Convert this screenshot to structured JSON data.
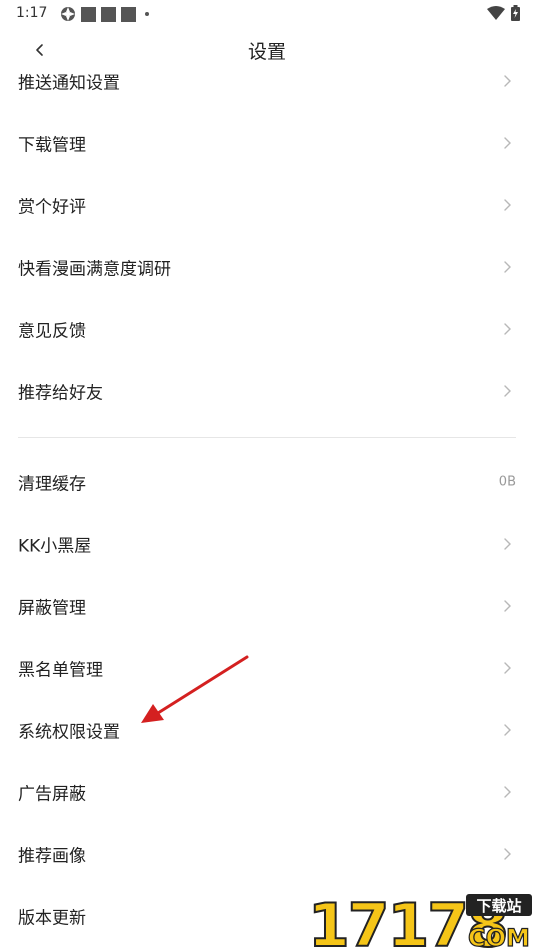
{
  "status_bar": {
    "time": "1:17"
  },
  "header": {
    "title": "设置"
  },
  "groups": [
    {
      "items": [
        {
          "label": "推送通知设置"
        },
        {
          "label": "下载管理"
        },
        {
          "label": "赏个好评"
        },
        {
          "label": "快看漫画满意度调研"
        },
        {
          "label": "意见反馈"
        },
        {
          "label": "推荐给好友"
        }
      ]
    },
    {
      "items": [
        {
          "label": "清理缓存",
          "value": "0B"
        },
        {
          "label": "KK小黑屋"
        },
        {
          "label": "屏蔽管理"
        },
        {
          "label": "黑名单管理"
        },
        {
          "label": "系统权限设置"
        },
        {
          "label": "广告屏蔽"
        },
        {
          "label": "推荐画像"
        },
        {
          "label": "版本更新"
        }
      ]
    }
  ],
  "watermark": {
    "digits": "17178",
    "badge": "下载站",
    "suffix": "COM"
  },
  "colors": {
    "arrow": "#d42020",
    "watermark_yellow": "#f5c518",
    "chevron": "#b8b8b8"
  }
}
